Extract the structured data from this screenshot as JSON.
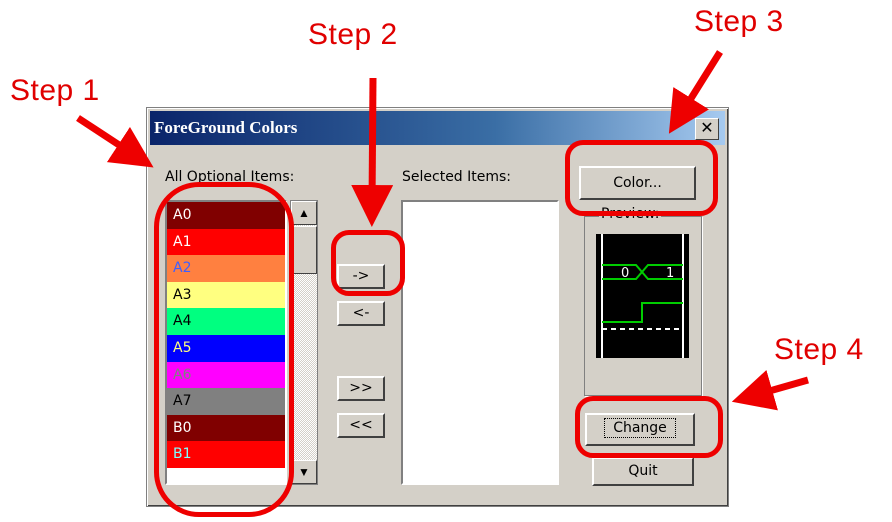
{
  "annotations": {
    "step1": "Step 1",
    "step2": "Step 2",
    "step3": "Step 3",
    "step4": "Step 4"
  },
  "window": {
    "title": "ForeGround Colors",
    "close_glyph": "✕"
  },
  "labels": {
    "optional": "All Optional Items:",
    "selected": "Selected Items:",
    "preview": "Preview:"
  },
  "optional_items": [
    {
      "label": "A0",
      "bg": "#800000",
      "fg": "#ffffff"
    },
    {
      "label": "A1",
      "bg": "#ff0000",
      "fg": "#ffffff"
    },
    {
      "label": "A2",
      "bg": "#ff8040",
      "fg": "#4060ff"
    },
    {
      "label": "A3",
      "bg": "#ffff80",
      "fg": "#000000"
    },
    {
      "label": "A4",
      "bg": "#00ff80",
      "fg": "#000000"
    },
    {
      "label": "A5",
      "bg": "#0000ff",
      "fg": "#ffff80"
    },
    {
      "label": "A6",
      "bg": "#ff00ff",
      "fg": "#808080"
    },
    {
      "label": "A7",
      "bg": "#808080",
      "fg": "#000000"
    },
    {
      "label": "B0",
      "bg": "#800000",
      "fg": "#ffffff"
    },
    {
      "label": "B1",
      "bg": "#ff0000",
      "fg": "#80ffff"
    }
  ],
  "buttons": {
    "add": "->",
    "remove": "<-",
    "add_all": ">>",
    "remove_all": "<<",
    "color": "Color...",
    "change": "Change",
    "quit": "Quit"
  },
  "scroll": {
    "up": "▲",
    "down": "▼"
  },
  "preview": {
    "bus_left": "0",
    "bus_right": "1"
  }
}
